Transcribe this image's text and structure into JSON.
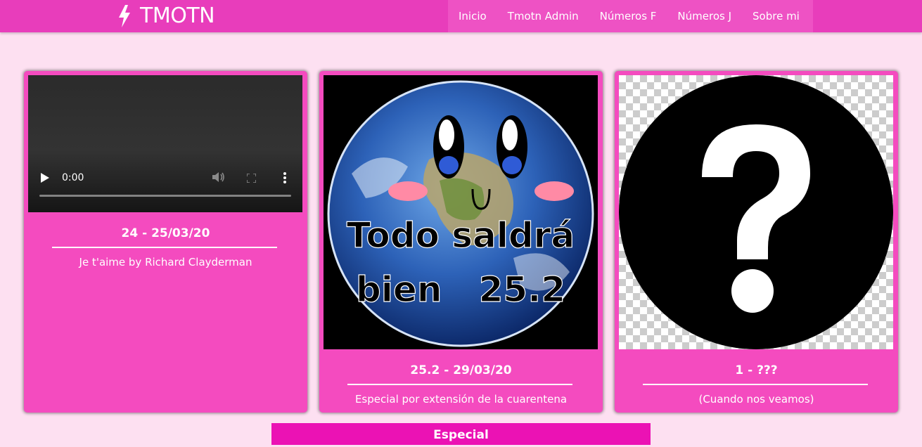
{
  "brand": {
    "name": "TMOTN",
    "icon": "bolt-icon"
  },
  "nav": {
    "items": [
      {
        "label": "Inicio"
      },
      {
        "label": "Tmotn Admin"
      },
      {
        "label": "Números F"
      },
      {
        "label": "Números J"
      },
      {
        "label": "Sobre mi"
      }
    ]
  },
  "cards": [
    {
      "media": "video-player",
      "video_time": "0:00",
      "title": "24 - 25/03/20",
      "description": "Je t'aime by Richard Clayderman"
    },
    {
      "media": "earth-image",
      "image_text_line1": "Todo saldrá",
      "image_text_line2": "bien   25.2",
      "title": "25.2 - 29/03/20",
      "description": "Especial por extensión de la cuarentena"
    },
    {
      "media": "question-mark-image",
      "title": "1 - ???",
      "description": "(Cuando nos veamos)"
    }
  ],
  "section_label": "Especial",
  "colors": {
    "navbar": "#e83dbb",
    "page_bg": "#fde0f1",
    "card_bg": "#f44bbf",
    "special_bg": "#eb12b4"
  }
}
